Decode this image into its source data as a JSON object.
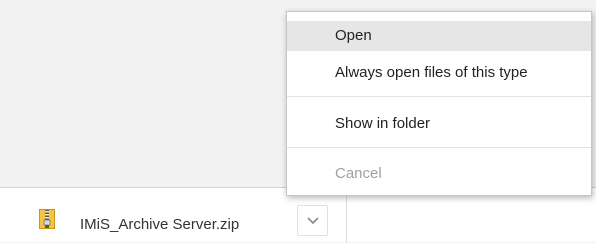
{
  "download_shelf": {
    "file_name": "IMiS_Archive Server.zip",
    "file_icon": "zip-archive-icon",
    "menu_button_icon": "chevron-down-icon"
  },
  "context_menu": {
    "items": [
      {
        "label": "Open",
        "state": "highlighted"
      },
      {
        "label": "Always open files of this type",
        "state": "normal"
      },
      {
        "label": "Show in folder",
        "state": "normal"
      },
      {
        "label": "Cancel",
        "state": "disabled"
      }
    ]
  }
}
